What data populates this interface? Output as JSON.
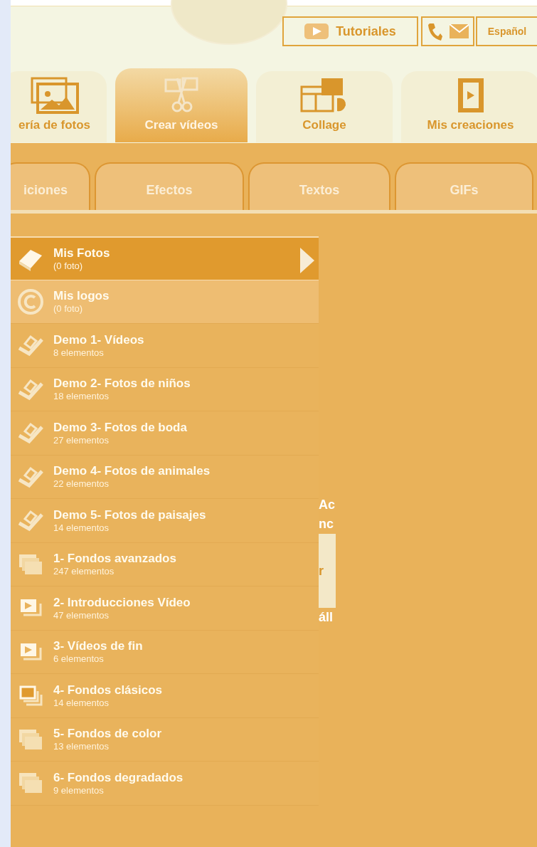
{
  "header": {
    "buttons": [
      {
        "kind": "tutorials",
        "label": "Tutoriales"
      },
      {
        "kind": "contact"
      },
      {
        "kind": "language",
        "label": "Español"
      }
    ]
  },
  "main_tabs": [
    {
      "label": "ería de fotos",
      "kind": "gallery",
      "selected": false
    },
    {
      "label": "Crear vídeos",
      "kind": "scissors",
      "selected": true
    },
    {
      "label": "Collage",
      "kind": "collage",
      "selected": false
    },
    {
      "label": "Mis creaciones",
      "kind": "film",
      "selected": false
    }
  ],
  "sub_tabs": [
    {
      "label": "iciones",
      "selected": false
    },
    {
      "label": "Efectos",
      "selected": false
    },
    {
      "label": "Textos",
      "selected": false
    },
    {
      "label": "GIFs",
      "selected": false
    }
  ],
  "albums": [
    {
      "kind": "book",
      "title": "Mis Fotos",
      "count": "(0 foto)",
      "selected": true,
      "highlighted": false
    },
    {
      "kind": "copyright",
      "title": "Mis logos",
      "count": "(0 foto)",
      "selected": false,
      "highlighted": true
    },
    {
      "kind": "demo",
      "title": "Demo 1- Vídeos",
      "count": "8 elementos",
      "selected": false,
      "highlighted": false
    },
    {
      "kind": "demo",
      "title": "Demo 2- Fotos de niños",
      "count": "18 elementos",
      "selected": false,
      "highlighted": false
    },
    {
      "kind": "demo",
      "title": "Demo 3- Fotos de boda",
      "count": "27 elementos",
      "selected": false,
      "highlighted": false
    },
    {
      "kind": "demo",
      "title": "Demo 4- Fotos de animales",
      "count": "22 elementos",
      "selected": false,
      "highlighted": false
    },
    {
      "kind": "demo",
      "title": "Demo 5- Fotos de paisajes",
      "count": "14 elementos",
      "selected": false,
      "highlighted": false
    },
    {
      "kind": "stack",
      "title": "1- Fondos avanzados",
      "count": "247 elementos",
      "selected": false,
      "highlighted": false
    },
    {
      "kind": "video",
      "title": "2- Introducciones Vídeo",
      "count": "47 elementos",
      "selected": false,
      "highlighted": false
    },
    {
      "kind": "video",
      "title": "3- Vídeos de fin",
      "count": "6 elementos",
      "selected": false,
      "highlighted": false
    },
    {
      "kind": "frames",
      "title": "4- Fondos clásicos",
      "count": "14 elementos",
      "selected": false,
      "highlighted": false
    },
    {
      "kind": "stack",
      "title": "5- Fondos de color",
      "count": "13 elementos",
      "selected": false,
      "highlighted": false
    },
    {
      "kind": "stack",
      "title": "6- Fondos degradados",
      "count": "9 elementos",
      "selected": false,
      "highlighted": false
    }
  ],
  "hidden_panel_text": [
    "Ac",
    "nc",
    "r",
    "áll"
  ]
}
